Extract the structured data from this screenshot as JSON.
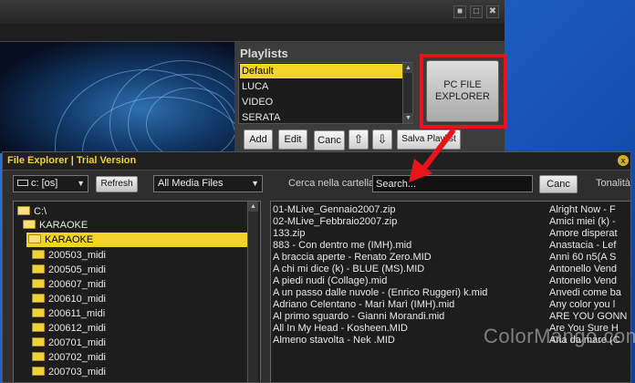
{
  "app": {
    "window_buttons": [
      "■",
      "□",
      "✖"
    ],
    "playlists": {
      "title": "Playlists",
      "items": [
        "Default",
        "LUCA",
        "VIDEO",
        "SERATA"
      ],
      "buttons": {
        "add": "Add",
        "edit": "Edit",
        "canc": "Canc",
        "up": "⇧",
        "down": "⇩",
        "save": "Salva Playlist"
      }
    },
    "pc_file_explorer": "PC FILE EXPLORER"
  },
  "file_explorer": {
    "title": "File Explorer | Trial Version",
    "close": "x",
    "drive": "c: [os]",
    "refresh": "Refresh",
    "media_filter": "All Media Files",
    "search_label": "Cerca nella cartella",
    "search_placeholder": "Search...",
    "canc": "Canc",
    "tonalita": "Tonalità",
    "tree": [
      {
        "label": "C:\\",
        "level": 0,
        "open": true
      },
      {
        "label": "KARAOKE",
        "level": 1,
        "open": true
      },
      {
        "label": "KARAOKE",
        "level": 2,
        "open": true,
        "selected": true
      },
      {
        "label": "200503_midi",
        "level": 3
      },
      {
        "label": "200505_midi",
        "level": 3
      },
      {
        "label": "200607_midi",
        "level": 3
      },
      {
        "label": "200610_midi",
        "level": 3
      },
      {
        "label": "200611_midi",
        "level": 3
      },
      {
        "label": "200612_midi",
        "level": 3
      },
      {
        "label": "200701_midi",
        "level": 3
      },
      {
        "label": "200702_midi",
        "level": 3
      },
      {
        "label": "200703_midi",
        "level": 3
      }
    ],
    "files": [
      {
        "name": "01-MLive_Gennaio2007.zip",
        "song": "Alright Now - F"
      },
      {
        "name": "02-MLive_Febbraio2007.zip",
        "song": "Amici miei (k) -"
      },
      {
        "name": "133.zip",
        "song": "Amore disperat"
      },
      {
        "name": "883 - Con dentro me (IMH).mid",
        "song": "Anastacia - Lef"
      },
      {
        "name": "A braccia aperte - Renato Zero.MID",
        "song": "Anni 60 n5(A S"
      },
      {
        "name": "A chi mi dice (k) - BLUE (MS).MID",
        "song": "Antonello Vend"
      },
      {
        "name": "A piedi nudi (Collage).mid",
        "song": "Antonello Vend"
      },
      {
        "name": "A un passo dalle nuvole - (Enrico Ruggeri)  k.mid",
        "song": "Anvedi come ba"
      },
      {
        "name": "Adriano Celentano - Marì Marì (IMH).mid",
        "song": "Any color you l"
      },
      {
        "name": "Al primo sguardo  - Gianni Morandi.mid",
        "song": "ARE YOU GONN"
      },
      {
        "name": "All In My Head - Kosheen.MID",
        "song": "Are You Sure H"
      },
      {
        "name": "Almeno stavolta - Nek .MID",
        "song": "Aria da mare (C"
      }
    ]
  },
  "watermark": "ColorMango.com"
}
